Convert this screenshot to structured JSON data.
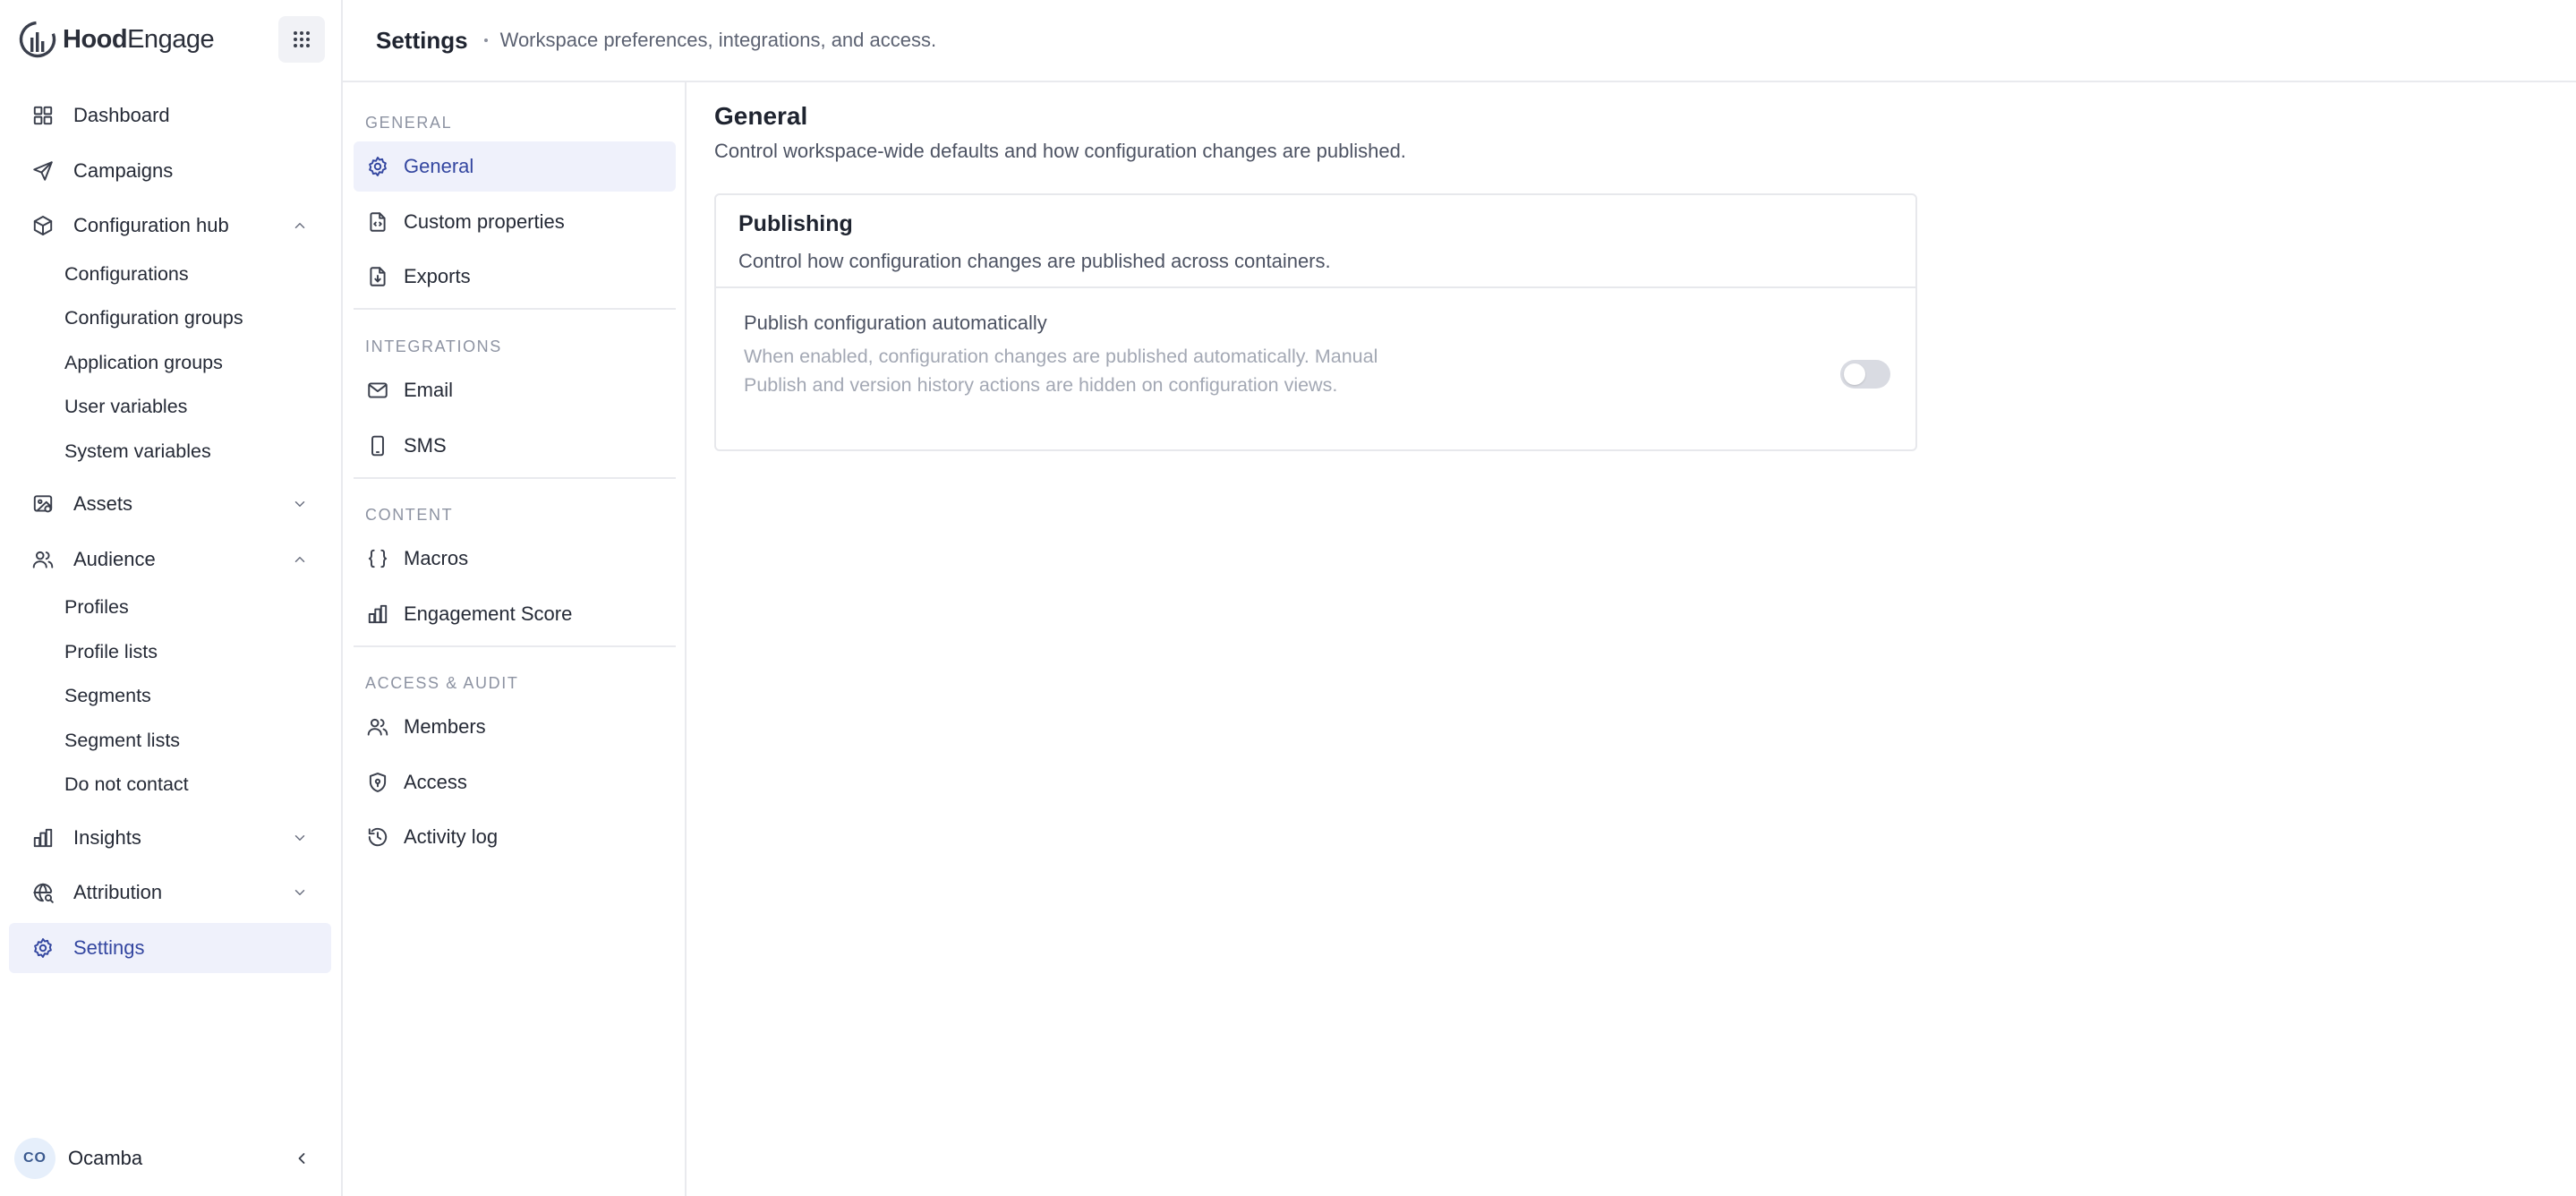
{
  "brand": {
    "name_bold": "Hood",
    "name_rest": "Engage"
  },
  "header": {
    "title": "Settings",
    "subtitle": "Workspace preferences, integrations, and access."
  },
  "sidebar": {
    "items": [
      {
        "label": "Dashboard",
        "icon": "dashboard-icon"
      },
      {
        "label": "Campaigns",
        "icon": "send-icon"
      },
      {
        "label": "Configuration hub",
        "icon": "cube-icon",
        "expanded": true,
        "children": [
          "Configurations",
          "Configuration groups",
          "Application groups",
          "User variables",
          "System variables"
        ]
      },
      {
        "label": "Assets",
        "icon": "image-icon",
        "expanded": false
      },
      {
        "label": "Audience",
        "icon": "users-icon",
        "expanded": true,
        "children": [
          "Profiles",
          "Profile lists",
          "Segments",
          "Segment lists",
          "Do not contact"
        ]
      },
      {
        "label": "Insights",
        "icon": "bar-chart-icon",
        "expanded": false
      },
      {
        "label": "Attribution",
        "icon": "globe-search-icon",
        "expanded": false
      },
      {
        "label": "Settings",
        "icon": "gear-icon",
        "active": true
      }
    ],
    "user": {
      "initials": "CO",
      "name": "Ocamba"
    }
  },
  "settings_nav": {
    "sections": [
      {
        "title": "GENERAL",
        "items": [
          {
            "label": "General",
            "icon": "gear-icon",
            "active": true
          },
          {
            "label": "Custom properties",
            "icon": "file-code-icon"
          },
          {
            "label": "Exports",
            "icon": "file-download-icon"
          }
        ]
      },
      {
        "title": "INTEGRATIONS",
        "items": [
          {
            "label": "Email",
            "icon": "mail-icon"
          },
          {
            "label": "SMS",
            "icon": "phone-icon"
          }
        ]
      },
      {
        "title": "CONTENT",
        "items": [
          {
            "label": "Macros",
            "icon": "braces-icon"
          },
          {
            "label": "Engagement Score",
            "icon": "bar-chart-icon"
          }
        ]
      },
      {
        "title": "ACCESS & AUDIT",
        "items": [
          {
            "label": "Members",
            "icon": "users-icon"
          },
          {
            "label": "Access",
            "icon": "shield-icon"
          },
          {
            "label": "Activity log",
            "icon": "history-icon"
          }
        ]
      }
    ]
  },
  "main": {
    "title": "General",
    "description": "Control workspace-wide defaults and how configuration changes are published.",
    "card": {
      "title": "Publishing",
      "description": "Control how configuration changes are published across containers.",
      "option": {
        "title": "Publish configuration automatically",
        "description": "When enabled, configuration changes are published automatically. Manual Publish and version history actions are hidden on configuration views.",
        "enabled": false
      }
    }
  },
  "colors": {
    "accent": "#3346a0",
    "active_bg": "#eff1fb",
    "toggle_off": "#d9dbe2"
  }
}
